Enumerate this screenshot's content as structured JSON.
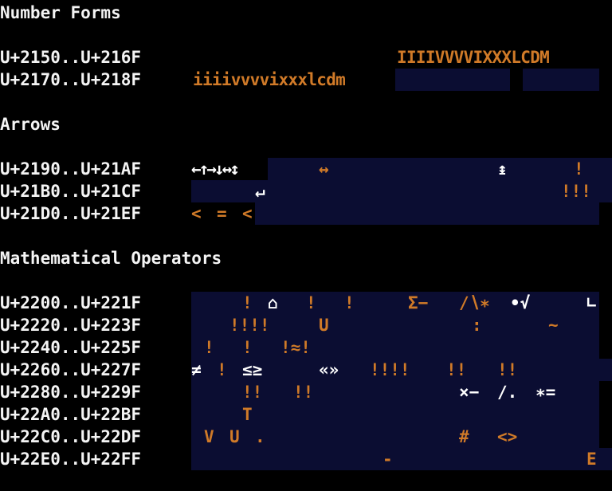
{
  "colors": {
    "background": "#000000",
    "label": "#f4f4f4",
    "glyph": "#d07a28",
    "grid": "#0b0d32"
  },
  "sections": [
    {
      "title": "Number Forms",
      "rows": [
        {
          "range": "U+2150..U+216F",
          "glyph_text": "IIIIVVVVIXXXLCDM"
        },
        {
          "range": "U+2170..U+218F",
          "glyph_text": "iiiivvvvixxxlcdm"
        }
      ]
    },
    {
      "title": "Arrows",
      "rows": [
        {
          "range": "U+2190..U+21AF",
          "glyphs": [
            "←↑→↓↔↕",
            "↔",
            "↨",
            "!"
          ]
        },
        {
          "range": "U+21B0..U+21CF",
          "glyphs": [
            "↵",
            "!!!"
          ]
        },
        {
          "range": "U+21D0..U+21EF",
          "glyphs": [
            "<",
            "=",
            "<"
          ]
        }
      ]
    },
    {
      "title": "Mathematical Operators",
      "rows": [
        {
          "range": "U+2200..U+221F",
          "glyphs": [
            "!",
            "⌂",
            "!",
            "!",
            "Σ−",
            "∕∖∗",
            "•√",
            "∟"
          ]
        },
        {
          "range": "U+2220..U+223F",
          "glyphs": [
            "!!!!",
            "U",
            ":",
            "~"
          ]
        },
        {
          "range": "U+2240..U+225F",
          "glyphs": [
            "!",
            "!",
            "!≈!"
          ]
        },
        {
          "range": "U+2260..U+227F",
          "glyphs": [
            "≠",
            "!",
            "≤≥",
            "«»",
            "!!!!",
            "!!",
            "!!"
          ]
        },
        {
          "range": "U+2280..U+229F",
          "glyphs": [
            "!!",
            "!!",
            "×−",
            "∕.",
            "∗="
          ]
        },
        {
          "range": "U+22A0..U+22BF",
          "glyphs": [
            "T"
          ]
        },
        {
          "range": "U+22C0..U+22DF",
          "glyphs": [
            "V",
            "U",
            ".",
            "#",
            "<>"
          ]
        },
        {
          "range": "U+22E0..U+22FF",
          "glyphs": [
            "-",
            "E"
          ]
        }
      ]
    }
  ]
}
